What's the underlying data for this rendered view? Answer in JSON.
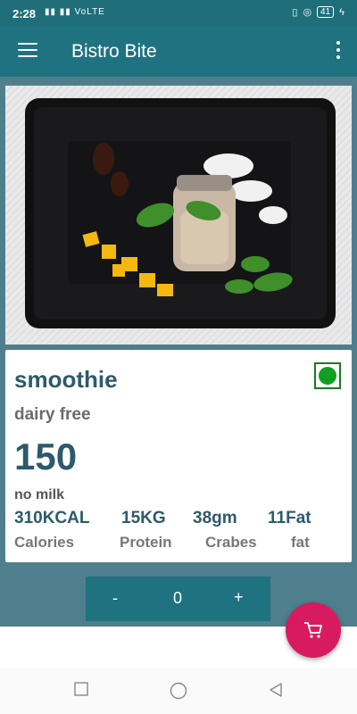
{
  "status_bar": {
    "time": "2:28",
    "signal_text": "▮▮ ▮▮ VoLTE",
    "battery": "41"
  },
  "app_bar": {
    "title": "Bistro Bite",
    "menu_icon": "hamburger-menu-icon",
    "more_icon": "more-vert-icon"
  },
  "item": {
    "name": "smoothie",
    "subtitle": "dairy free",
    "price": "150",
    "note": "no milk",
    "veg_badge_color": "#10a020",
    "nutrition": [
      {
        "value": "310KCAL",
        "label": "Calories"
      },
      {
        "value": "15KG",
        "label": "Protein"
      },
      {
        "value": "38gm",
        "label": "Crabes"
      },
      {
        "value": "11Fat",
        "label": "fat"
      }
    ]
  },
  "quantity": {
    "minus": "-",
    "value": "0",
    "plus": "+"
  },
  "fab": {
    "icon": "cart-icon",
    "color": "#d81b60"
  },
  "nav": {
    "back": "back-icon",
    "home": "home-icon",
    "recents": "recents-icon"
  },
  "colors": {
    "primary": "#1f7280",
    "content_bg": "#4f7f8c",
    "accent": "#d81b60"
  }
}
